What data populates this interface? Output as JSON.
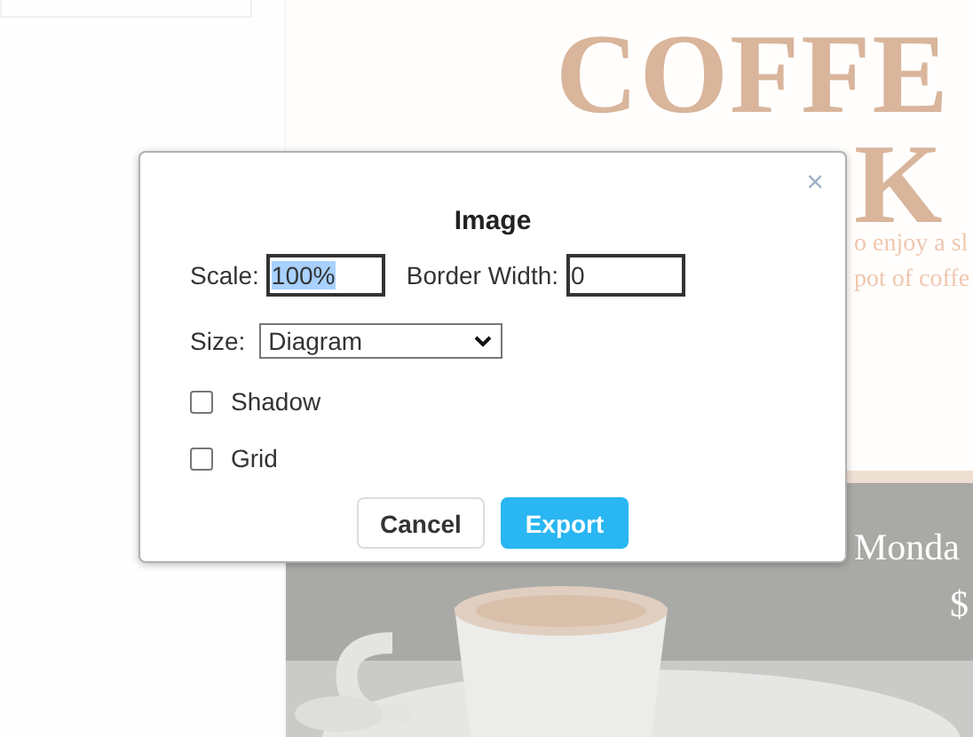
{
  "poster": {
    "title_lines": [
      "COFFE",
      "K"
    ],
    "body_lines": [
      "o enjoy a sl",
      "pot of coffe"
    ],
    "photo_lines": [
      "Monda",
      "$"
    ]
  },
  "dialog": {
    "title": "Image",
    "close": "×",
    "fields": [
      {
        "label": "Scale:",
        "value": "100%",
        "selected": true
      },
      {
        "label": "Border Width:",
        "value": "0",
        "selected": false
      }
    ],
    "size": {
      "label": "Size:",
      "value": "Diagram"
    },
    "checkboxes": [
      {
        "label": "Shadow",
        "checked": false
      },
      {
        "label": "Grid",
        "checked": false
      }
    ],
    "buttons": [
      {
        "label": "Cancel",
        "kind": "secondary"
      },
      {
        "label": "Export",
        "kind": "primary"
      }
    ]
  }
}
